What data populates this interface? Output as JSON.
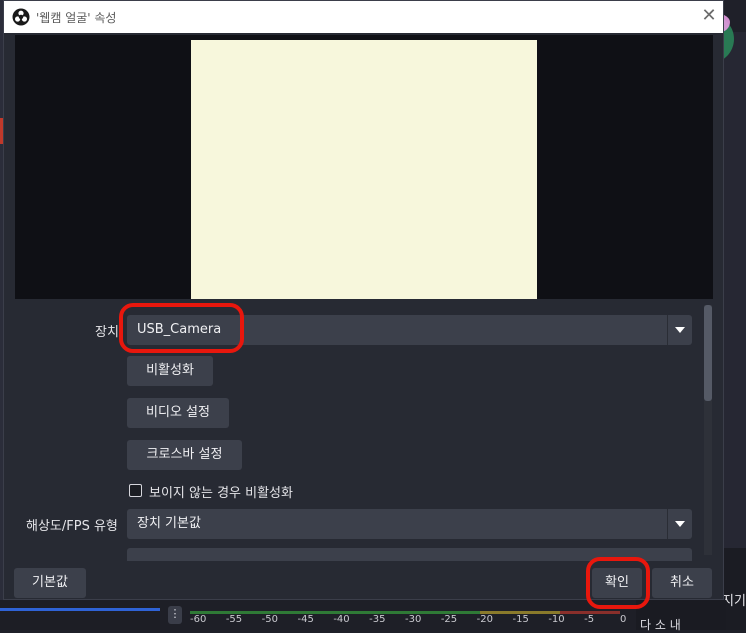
{
  "dialog": {
    "title": "'웹캠 얼굴' 속성",
    "close_glyph": "✕"
  },
  "properties": {
    "device_label": "장치",
    "device_value": "USB_Camera",
    "deactivate_button": "비활성화",
    "video_settings_button": "비디오 설정",
    "crossbar_settings_button": "크로스바 설정",
    "deactivate_when_hidden_label": "보이지 않는 경우 비활성화",
    "deactivate_when_hidden_checked": false,
    "resolution_fps_label": "해상도/FPS 유형",
    "resolution_fps_value": "장치 기본값"
  },
  "footer": {
    "defaults_button": "기본값",
    "ok_button": "확인",
    "cancel_button": "취소"
  },
  "background": {
    "right_side_text": "지기",
    "bottom_right_text": "다 소 내",
    "meter_dots": "⋮",
    "meter_ticks": [
      "-60",
      "-55",
      "-50",
      "-45",
      "-40",
      "-35",
      "-30",
      "-25",
      "-20",
      "-15",
      "-10",
      "-5",
      "0"
    ]
  },
  "colors": {
    "highlight": "#e8170d",
    "preview_fill": "#f7f7dc"
  }
}
